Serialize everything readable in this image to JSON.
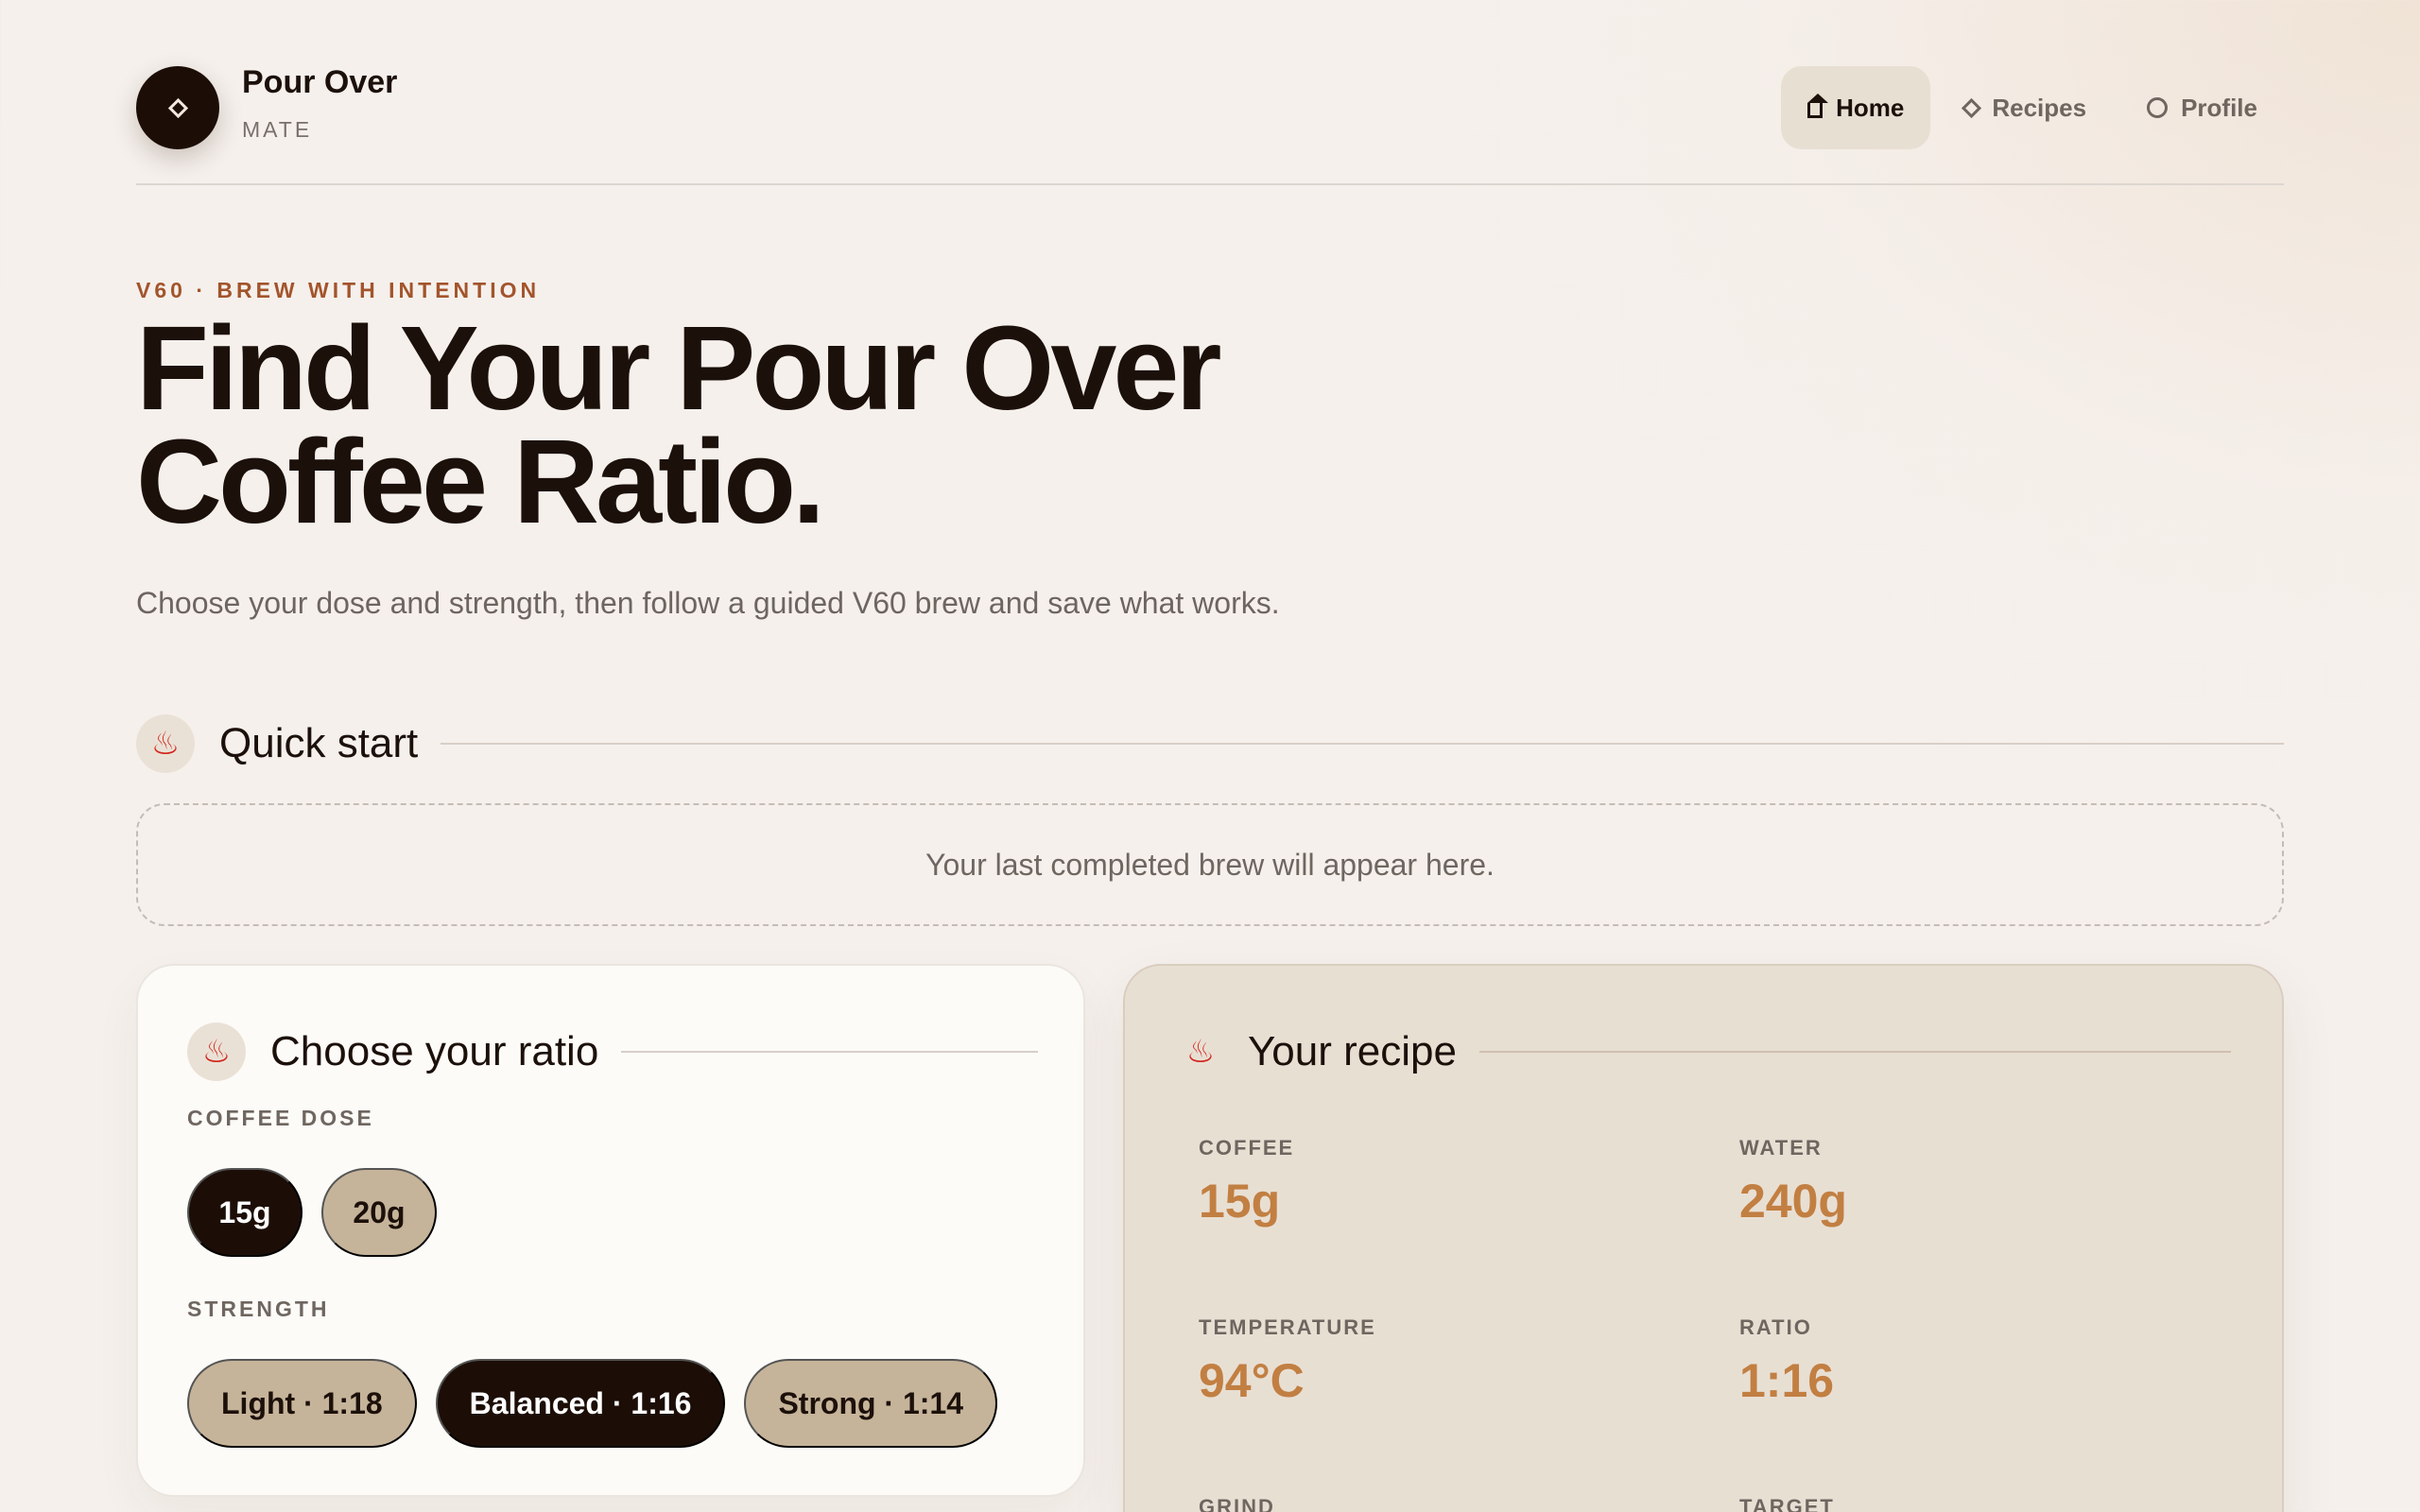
{
  "brand": {
    "name": "Pour Over",
    "sub": "MATE"
  },
  "nav": [
    {
      "label": "Home",
      "icon": "home-icon",
      "active": true
    },
    {
      "label": "Recipes",
      "icon": "diamond-icon",
      "active": false
    },
    {
      "label": "Profile",
      "icon": "circle-icon",
      "active": false
    }
  ],
  "hero": {
    "eyebrow": "V60 · BREW WITH INTENTION",
    "title_line1": "Find Your Pour Over",
    "title_line2": "Coffee Ratio.",
    "subtitle": "Choose your dose and strength, then follow a guided V60 brew and save what works."
  },
  "quick_start": {
    "title": "Quick start",
    "icon": "steam-icon",
    "empty_text": "Your last completed brew will appear here."
  },
  "ratio": {
    "title": "Choose your ratio",
    "dose_label": "COFFEE DOSE",
    "doses": [
      {
        "label": "15g",
        "selected": true
      },
      {
        "label": "20g",
        "selected": false
      }
    ],
    "strength_label": "STRENGTH",
    "strengths": [
      {
        "label": "Light · 1:18",
        "selected": false
      },
      {
        "label": "Balanced · 1:16",
        "selected": true
      },
      {
        "label": "Strong · 1:14",
        "selected": false
      }
    ]
  },
  "recipe": {
    "title": "Your recipe",
    "stats": [
      {
        "label": "COFFEE",
        "value": "15g"
      },
      {
        "label": "WATER",
        "value": "240g"
      },
      {
        "label": "TEMPERATURE",
        "value": "94°C"
      },
      {
        "label": "RATIO",
        "value": "1:16"
      },
      {
        "label": "GRIND",
        "value": ""
      },
      {
        "label": "TARGET",
        "value": ""
      }
    ]
  },
  "colors": {
    "background": "#f5f0ec",
    "dark": "#1c0e07",
    "accent": "#c27f42",
    "eyebrow": "#a3542c",
    "pill": "#c6b49a",
    "recipe_card": "#e8dfd3",
    "steam_icon": "#d2261c"
  }
}
